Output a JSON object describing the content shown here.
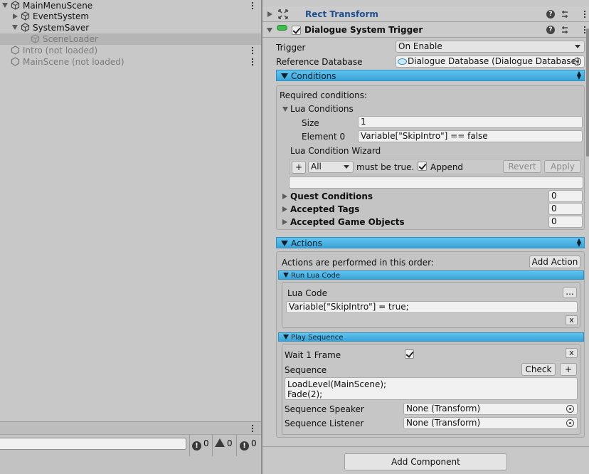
{
  "hierarchy": {
    "items": [
      {
        "label": "MainMenuScene"
      },
      {
        "label": "EventSystem"
      },
      {
        "label": "SystemSaver"
      },
      {
        "label": "SceneLoader"
      },
      {
        "label": "Intro (not loaded)"
      },
      {
        "label": "MainScene (not loaded)"
      }
    ],
    "console_counts": {
      "info": "0",
      "warning": "0",
      "error": "0"
    }
  },
  "inspector": {
    "rect_transform": {
      "title": "Rect Transform"
    },
    "dst": {
      "title": "Dialogue System Trigger",
      "trigger_label": "Trigger",
      "trigger_value": "On Enable",
      "refdb_label": "Reference Database",
      "refdb_value": "Dialogue Database (Dialogue Database)",
      "conditions": {
        "header": "Conditions",
        "required": "Required conditions:",
        "lua_conditions": "Lua Conditions",
        "size_label": "Size",
        "size_value": "1",
        "element0_label": "Element 0",
        "element0_value": "Variable[\"SkipIntro\"] == false",
        "wizard_label": "Lua Condition Wizard",
        "plus": "+",
        "all_value": "All",
        "must_be_true": "must be true.",
        "append": "Append",
        "revert": "Revert",
        "apply": "Apply",
        "wizard_text": "",
        "quest_label": "Quest Conditions",
        "quest_value": "0",
        "tags_label": "Accepted Tags",
        "tags_value": "0",
        "gameobjects_label": "Accepted Game Objects",
        "gameobjects_value": "0"
      },
      "actions": {
        "header": "Actions",
        "order_text": "Actions are performed in this order:",
        "add_action": "Add Action",
        "run_lua": {
          "header": "Run Lua Code",
          "label": "Lua Code",
          "ellipsis": "...",
          "code": "Variable[\"SkipIntro\"] = true;",
          "x": "x"
        },
        "play_sequence": {
          "header": "Play Sequence",
          "wait_label": "Wait 1 Frame",
          "x": "x",
          "sequence_label": "Sequence",
          "check": "Check",
          "plus": "+",
          "sequence_text": "LoadLevel(MainScene);\nFade(2);",
          "speaker_label": "Sequence Speaker",
          "speaker_value": "None (Transform)",
          "listener_label": "Sequence Listener",
          "listener_value": "None (Transform)"
        }
      }
    },
    "add_component": "Add Component"
  },
  "colors": {
    "accent_blue": "#3aa5d9",
    "rect_title": "#1f4f8f",
    "toggle_green": "#3cbf4a"
  }
}
